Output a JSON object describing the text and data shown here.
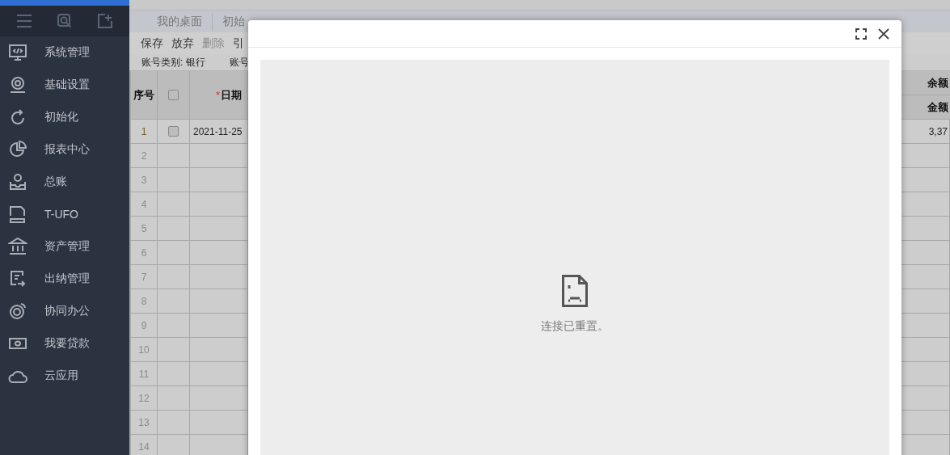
{
  "sidebar": {
    "items": [
      {
        "label": "系统管理"
      },
      {
        "label": "基础设置"
      },
      {
        "label": "初始化"
      },
      {
        "label": "报表中心"
      },
      {
        "label": "总账"
      },
      {
        "label": "T-UFO"
      },
      {
        "label": "资产管理"
      },
      {
        "label": "出纳管理"
      },
      {
        "label": "协同办公"
      },
      {
        "label": "我要贷款"
      },
      {
        "label": "云应用"
      }
    ]
  },
  "tabs": [
    {
      "label": "我的桌面",
      "selected": false
    },
    {
      "label": "初始",
      "selected": false
    }
  ],
  "toolbar": [
    {
      "label": "保存",
      "disabled": false
    },
    {
      "label": "放弃",
      "disabled": false
    },
    {
      "label": "删除",
      "disabled": true
    },
    {
      "label": "引",
      "disabled": false
    }
  ],
  "info": [
    "账号类别: 银行",
    "账号"
  ],
  "table": {
    "columns": {
      "number": "序号",
      "header_checked": false,
      "date": "日期",
      "date_required_mark": "*",
      "balance": "余额",
      "amount": "金额"
    },
    "rows": [
      {
        "number": "1",
        "checked": false,
        "date": "2021-11-25",
        "amount": "3,37"
      },
      {
        "number": "2"
      },
      {
        "number": "3"
      },
      {
        "number": "4"
      },
      {
        "number": "5"
      },
      {
        "number": "6"
      },
      {
        "number": "7"
      },
      {
        "number": "8"
      },
      {
        "number": "9"
      },
      {
        "number": "10"
      },
      {
        "number": "11"
      },
      {
        "number": "12"
      },
      {
        "number": "13"
      },
      {
        "number": "14"
      }
    ]
  },
  "dialog": {
    "message": "连接已重置。"
  }
}
